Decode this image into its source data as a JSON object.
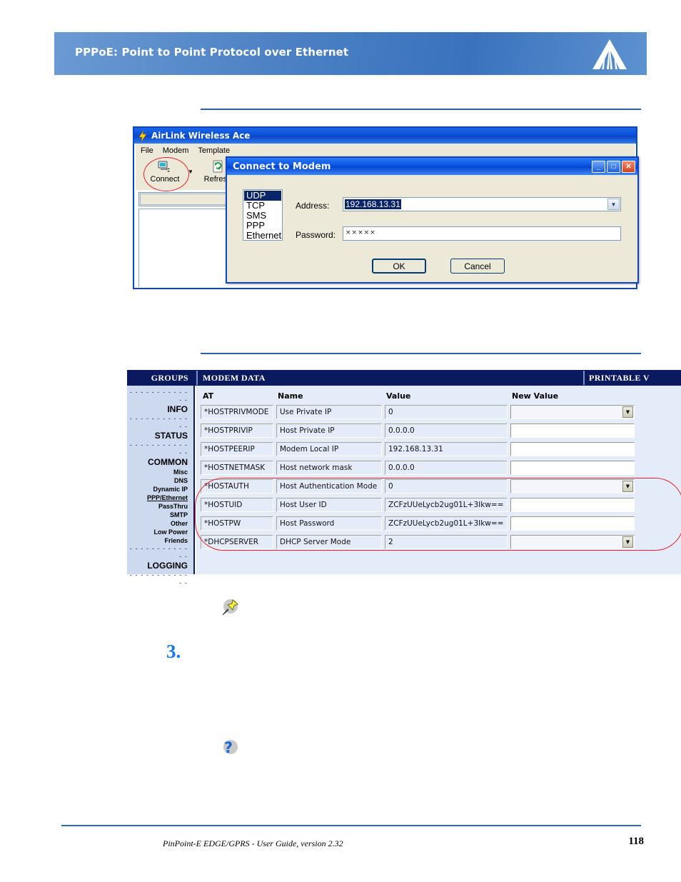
{
  "header": {
    "title": "PPPoE: Point to Point Protocol over Ethernet",
    "logo_icon": "airlink-logo-icon",
    "background_color": "#4c81c4"
  },
  "figure_ace": {
    "window_title": "AirLink Wireless Ace",
    "title_icon": "lightning-bolt-icon",
    "menu": [
      "File",
      "Modem",
      "Template"
    ],
    "toolbar": [
      {
        "label": "Connect",
        "icon": "connect-modem-icon",
        "has_dropdown": true
      },
      {
        "label": "Refresh",
        "icon": "refresh-icon",
        "has_dropdown": false
      }
    ],
    "highlight": "red-ellipse-around-connect",
    "dialog": {
      "title": "Connect to Modem",
      "window_buttons": [
        {
          "name": "minimize",
          "glyph": "_"
        },
        {
          "name": "maximize",
          "glyph": "□"
        },
        {
          "name": "close",
          "glyph": "✕"
        }
      ],
      "protocols": [
        "UDP",
        "TCP",
        "SMS",
        "PPP",
        "Ethernet"
      ],
      "selected_protocol": "UDP",
      "address_label": "Address:",
      "address_value": "192.168.13.31",
      "password_label": "Password:",
      "password_value": "×××××",
      "ok_label": "OK",
      "cancel_label": "Cancel"
    }
  },
  "figure_table": {
    "header": {
      "groups": "GROUPS",
      "modem_data": "MODEM DATA",
      "printable": "PRINTABLE V"
    },
    "sidebar": [
      {
        "text": "- - - - - - - - - - - - -",
        "type": "dash"
      },
      {
        "text": "INFO",
        "type": "major"
      },
      {
        "text": "- - - - - - - - - - - - -",
        "type": "dash"
      },
      {
        "text": "STATUS",
        "type": "major"
      },
      {
        "text": "- - - - - - - - - - - - -",
        "type": "dash"
      },
      {
        "text": "COMMON",
        "type": "major"
      },
      {
        "text": "Misc",
        "type": "minor"
      },
      {
        "text": "DNS",
        "type": "minor"
      },
      {
        "text": "Dynamic IP",
        "type": "minor"
      },
      {
        "text": "PPP/Ethernet",
        "type": "minor-active"
      },
      {
        "text": "PassThru",
        "type": "minor"
      },
      {
        "text": "SMTP",
        "type": "minor"
      },
      {
        "text": "Other",
        "type": "minor"
      },
      {
        "text": "Low Power",
        "type": "minor"
      },
      {
        "text": "Friends",
        "type": "minor"
      },
      {
        "text": "- - - - - - - - - - - - -",
        "type": "dash"
      },
      {
        "text": "LOGGING",
        "type": "major"
      },
      {
        "text": "- - - - - - - - - - - - -",
        "type": "dash"
      }
    ],
    "columns": [
      "AT",
      "Name",
      "Value",
      "New Value"
    ],
    "rows": [
      {
        "at": "*HOSTPRIVMODE",
        "name": "Use Private IP",
        "value": "0",
        "new_value": "",
        "dropdown": true,
        "highlighted": false
      },
      {
        "at": "*HOSTPRIVIP",
        "name": "Host Private IP",
        "value": "0.0.0.0",
        "new_value": "",
        "dropdown": false,
        "highlighted": false
      },
      {
        "at": "*HOSTPEERIP",
        "name": "Modem Local IP",
        "value": "192.168.13.31",
        "new_value": "",
        "dropdown": false,
        "highlighted": false
      },
      {
        "at": "*HOSTNETMASK",
        "name": "Host network mask",
        "value": "0.0.0.0",
        "new_value": "",
        "dropdown": false,
        "highlighted": false
      },
      {
        "at": "*HOSTAUTH",
        "name": "Host Authentication Mode",
        "value": "0",
        "new_value": "",
        "dropdown": true,
        "highlighted": true
      },
      {
        "at": "*HOSTUID",
        "name": "Host User ID",
        "value": "ZCFzUUeLycb2ug01L+3Ikw==",
        "new_value": "",
        "dropdown": false,
        "highlighted": true
      },
      {
        "at": "*HOSTPW",
        "name": "Host Password",
        "value": "ZCFzUUeLycb2ug01L+3Ikw==",
        "new_value": "",
        "dropdown": false,
        "highlighted": true
      },
      {
        "at": "*DHCPSERVER",
        "name": "DHCP Server Mode",
        "value": "2",
        "new_value": "",
        "dropdown": true,
        "highlighted": true
      }
    ],
    "highlight": "red-oval-around-last-four-rows"
  },
  "callouts": {
    "note_icon": "yellow-pushpin-icon",
    "tip_icon": "blue-question-mark-icon",
    "step_number": "3."
  },
  "footer": {
    "text": "PinPoint-E EDGE/GPRS - User Guide, version 2.32",
    "page_number": "118"
  }
}
